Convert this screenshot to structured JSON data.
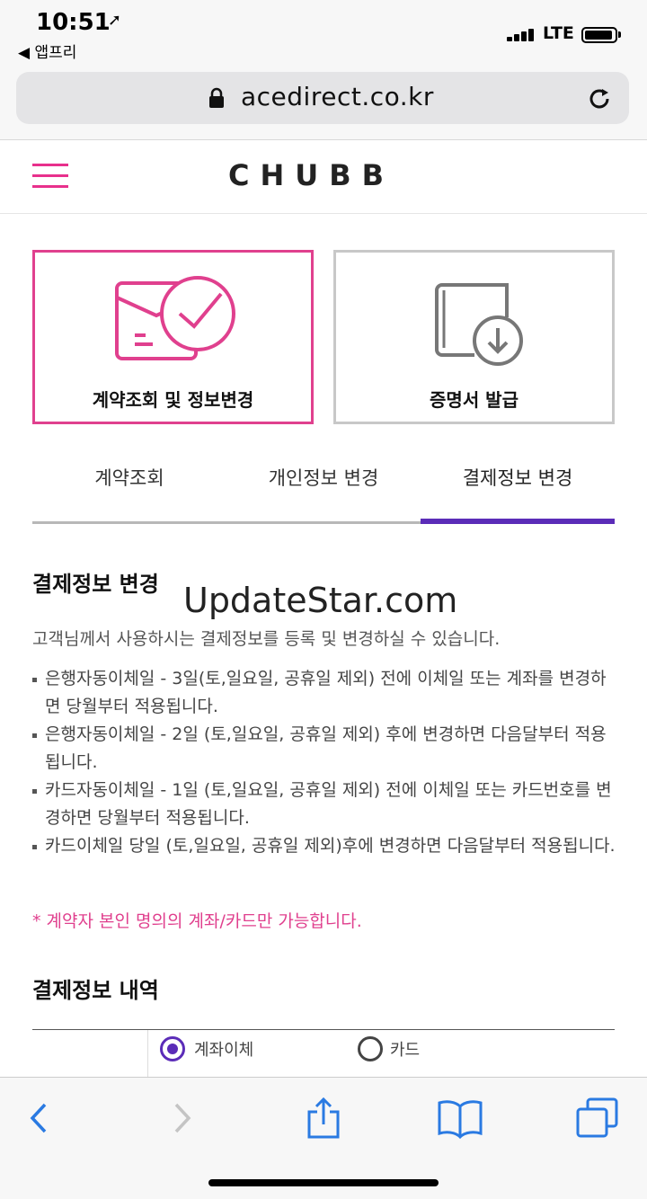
{
  "status_bar": {
    "time": "10:51",
    "back_app": "◀ 앱프리",
    "network": "LTE"
  },
  "browser": {
    "url": "acedirect.co.kr"
  },
  "site": {
    "logo": "CHUBB"
  },
  "cards": [
    {
      "label": "계약조회 및 정보변경",
      "icon": "document-check-icon",
      "selected": true
    },
    {
      "label": "증명서 발급",
      "icon": "book-download-icon",
      "selected": false
    }
  ],
  "tabs": [
    {
      "label": "계약조회",
      "active": false
    },
    {
      "label": "개인정보 변경",
      "active": false
    },
    {
      "label": "결제정보 변경",
      "active": true
    }
  ],
  "section": {
    "title": "결제정보 변경",
    "description": "고객님께서 사용하시는 결제정보를 등록 및 변경하실 수 있습니다.",
    "bullets": [
      "은행자동이체일 - 3일(토,일요일, 공휴일 제외) 전에 이체일 또는 계좌를 변경하면 당월부터 적용됩니다.",
      "은행자동이체일 - 2일 (토,일요일, 공휴일 제외) 후에 변경하면 다음달부터 적용됩니다.",
      "카드자동이체일 - 1일 (토,일요일, 공휴일 제외) 전에 이체일 또는 카드번호를 변경하면 당월부터 적용됩니다.",
      "카드이체일 당일 (토,일요일, 공휴일 제외)후에 변경하면 다음달부터 적용됩니다."
    ],
    "notice": "* 계약자 본인 명의의 계좌/카드만 가능합니다."
  },
  "history": {
    "title": "결제정보 내역",
    "options": [
      {
        "label": "계좌이체",
        "checked": true
      },
      {
        "label": "카드",
        "checked": false
      }
    ]
  },
  "watermark": "UpdateStar.com",
  "colors": {
    "accent_pink": "#e0408e",
    "accent_purple": "#5b2cb8",
    "ios_blue": "#2a7ae2"
  }
}
